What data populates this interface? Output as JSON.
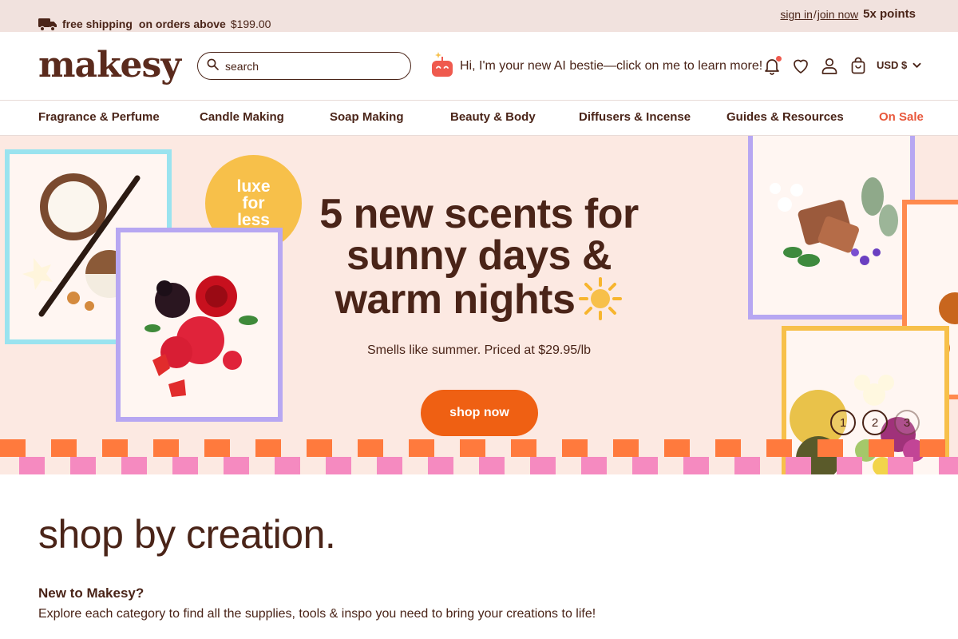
{
  "topbar": {
    "shipping_lead": "free shipping",
    "shipping_rest": "on orders above",
    "shipping_amount": "$199.00",
    "sign_in": "sign in",
    "divider": "/",
    "join_now": "join now",
    "points": "5x points"
  },
  "header": {
    "logo": "makesy",
    "search_placeholder": "search",
    "ai_prompt": "Hi, I'm your new AI bestie—click on me to learn more!",
    "currency": "USD $"
  },
  "nav": {
    "items": [
      "Fragrance & Perfume",
      "Candle Making",
      "Soap Making",
      "Beauty & Body",
      "Diffusers & Incense",
      "Guides & Resources",
      "On Sale"
    ]
  },
  "hero": {
    "badge_line1": "luxe",
    "badge_line2": "for",
    "badge_line3": "less",
    "headline_line1": "5 new scents for",
    "headline_line2": "sunny days &",
    "headline_line3": "warm nights",
    "subtext": "Smells like summer. Priced at $29.95/lb",
    "cta": "shop now",
    "slides": [
      "1",
      "2",
      "3"
    ]
  },
  "section": {
    "title": "shop by creation.",
    "heading": "New to Makesy?",
    "description": "Explore each category to find all the supplies, tools & inspo you need to bring your creations to life!"
  },
  "colors": {
    "brand_brown": "#4a2418",
    "accent_orange": "#ef6013",
    "sale_red": "#e8573b",
    "promo_bg": "#f1e2de",
    "hero_bg": "#fce9e2",
    "badge_yellow": "#f7c04a"
  },
  "icons": [
    "truck-icon",
    "search-icon",
    "ai-bot-icon",
    "bell-icon",
    "heart-icon",
    "user-icon",
    "bag-icon",
    "chevron-down-icon",
    "sun-icon"
  ]
}
